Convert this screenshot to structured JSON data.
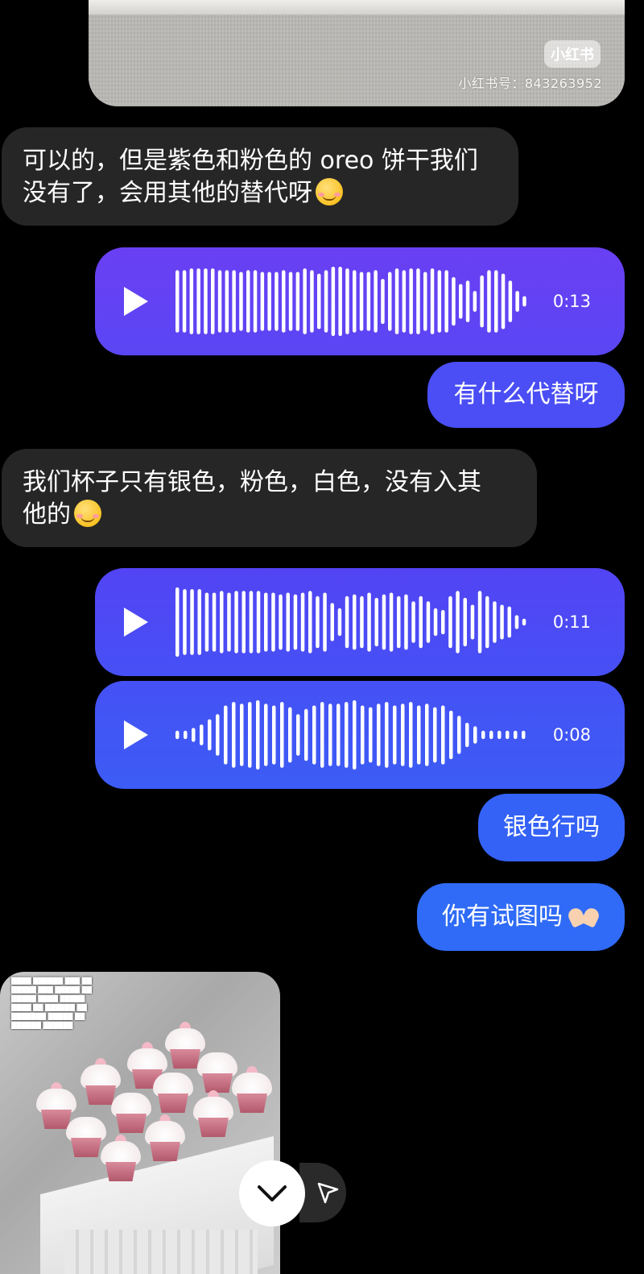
{
  "watermark": {
    "logo": "小红书",
    "id_text": "小红书号：843263952"
  },
  "messages": [
    {
      "type": "in",
      "text": "可以的，但是紫色和粉色的 oreo 饼干我们没有了，会用其他的替代呀",
      "emoji": "smiling-face-emoji"
    },
    {
      "type": "voice",
      "duration": "0:13"
    },
    {
      "type": "out",
      "text": "有什么代替呀"
    },
    {
      "type": "in",
      "text": "我们杯子只有银色，粉色，白色，没有入其他的",
      "emoji": "smiling-face-emoji"
    },
    {
      "type": "voice",
      "duration": "0:11"
    },
    {
      "type": "voice",
      "duration": "0:08"
    },
    {
      "type": "out",
      "text": "银色行吗"
    },
    {
      "type": "out",
      "text": "你有试图吗",
      "emoji": "heart-hands-emoji"
    }
  ],
  "m1": {
    "line1": "可以的，但是紫色和粉色的 oreo 饼干我们",
    "line2": "没有了，会用其他的替代呀"
  },
  "m4": {
    "line1": "我们杯子只有银色，粉色，白色，没有入其",
    "line2": "他的"
  },
  "voice1": {
    "duration": "0:13"
  },
  "voice2": {
    "duration": "0:11"
  },
  "voice3": {
    "duration": "0:08"
  },
  "m3": {
    "text": "有什么代替呀"
  },
  "m7": {
    "text": "银色行吗"
  },
  "m8": {
    "text": "你有试图吗"
  },
  "icons": {
    "play": "play-icon",
    "scroll_down": "chevron-down-icon",
    "share": "send-icon"
  },
  "colors": {
    "background": "#000000",
    "incoming_bubble": "#262626",
    "voice_gradient_top": "#6c3ff3",
    "voice_gradient_bottom": "#3f5cf5",
    "outgoing_text_purple": "#5640f4",
    "outgoing_text_blue": "#2f6bf6"
  }
}
